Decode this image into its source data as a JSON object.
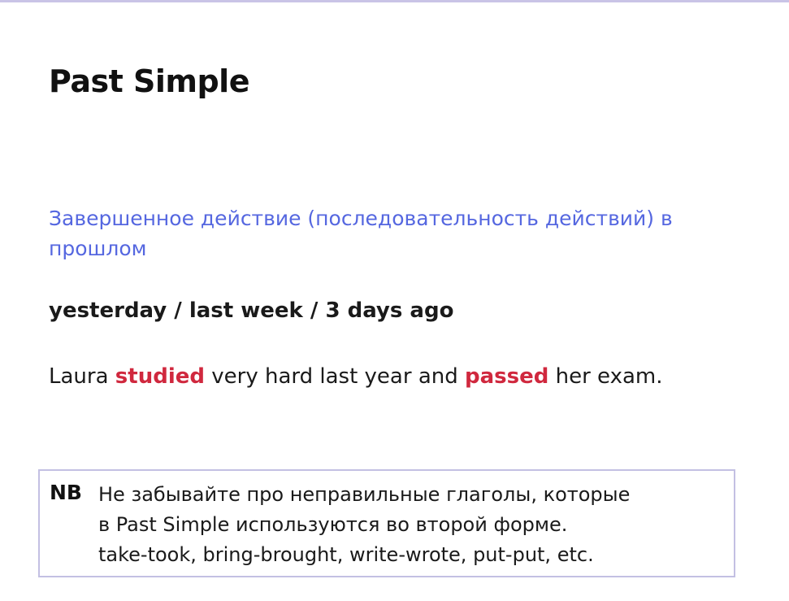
{
  "slide": {
    "title": "Past Simple",
    "definition": "Завершенное действие (последовательность действий) в прошлом",
    "time_markers": "yesterday / last week / 3 days ago",
    "example": {
      "part1": "Laura ",
      "verb1": "studied",
      "part2": " very hard last year and ",
      "verb2": "passed",
      "part3": " her exam."
    },
    "nb": {
      "label": "NB",
      "lines": [
        "Не забывайте про неправильные глаголы, которые",
        "в Past Simple используются во второй форме.",
        "take-took, bring-brought, write-wrote, put-put, etc."
      ]
    }
  },
  "colors": {
    "accent_blue": "#5567e0",
    "highlight_red": "#d0283e",
    "border_lavender": "#c3c0e3"
  }
}
